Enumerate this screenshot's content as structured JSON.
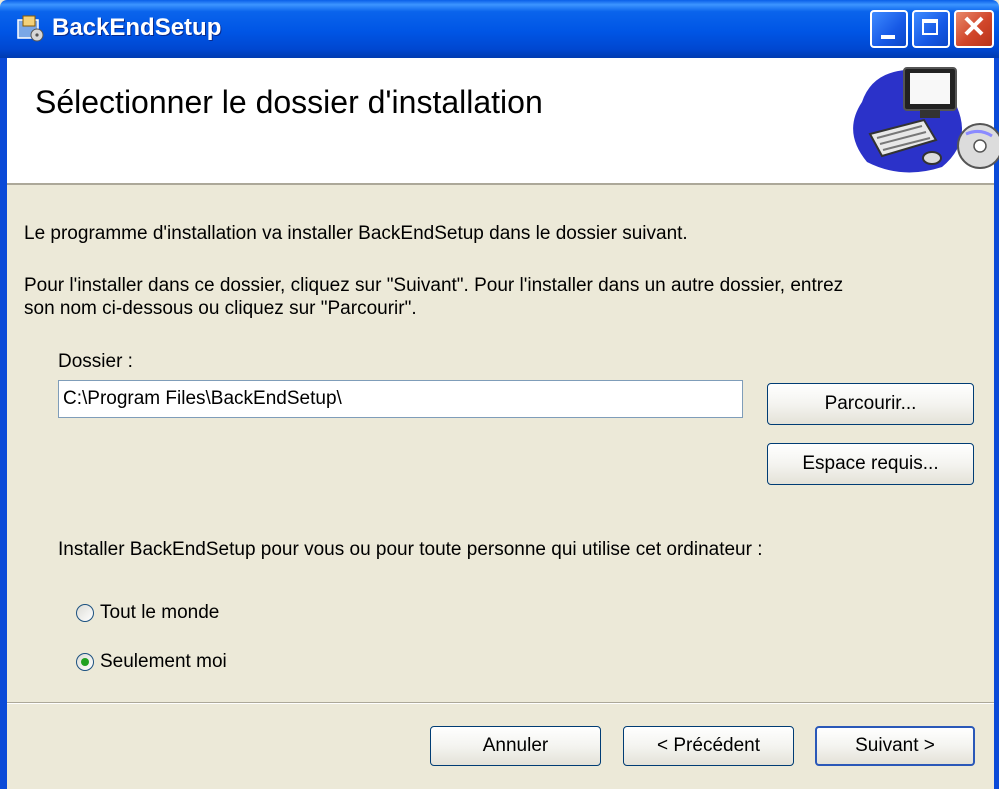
{
  "window": {
    "title": "BackEndSetup",
    "close_glyph": "✕"
  },
  "header": {
    "title": "Sélectionner le dossier d'installation",
    "illustration": "computer-cd-icon"
  },
  "body": {
    "intro": "Le programme d'installation va installer BackEndSetup dans le dossier suivant.",
    "instructions_line1": "Pour l'installer dans ce dossier, cliquez sur \"Suivant\". Pour l'installer dans un autre dossier, entrez",
    "instructions_line2": "son nom ci-dessous ou cliquez sur \"Parcourir\".",
    "folder_label": "Dossier :",
    "folder_value": "C:\\Program Files\\BackEndSetup\\",
    "browse_label": "Parcourir...",
    "disk_cost_label": "Espace requis...",
    "install_for_label": "Installer BackEndSetup pour vous ou pour toute personne qui utilise cet ordinateur :",
    "options": [
      {
        "label": "Tout le monde",
        "checked": false
      },
      {
        "label": "Seulement moi",
        "checked": true
      }
    ]
  },
  "footer": {
    "cancel_label": "Annuler",
    "back_label": "< Précédent",
    "next_label": "Suivant >"
  },
  "colors": {
    "titlebar": "#0055e5",
    "dialog_bg": "#ece9d8",
    "radio_dot": "#21a121"
  }
}
